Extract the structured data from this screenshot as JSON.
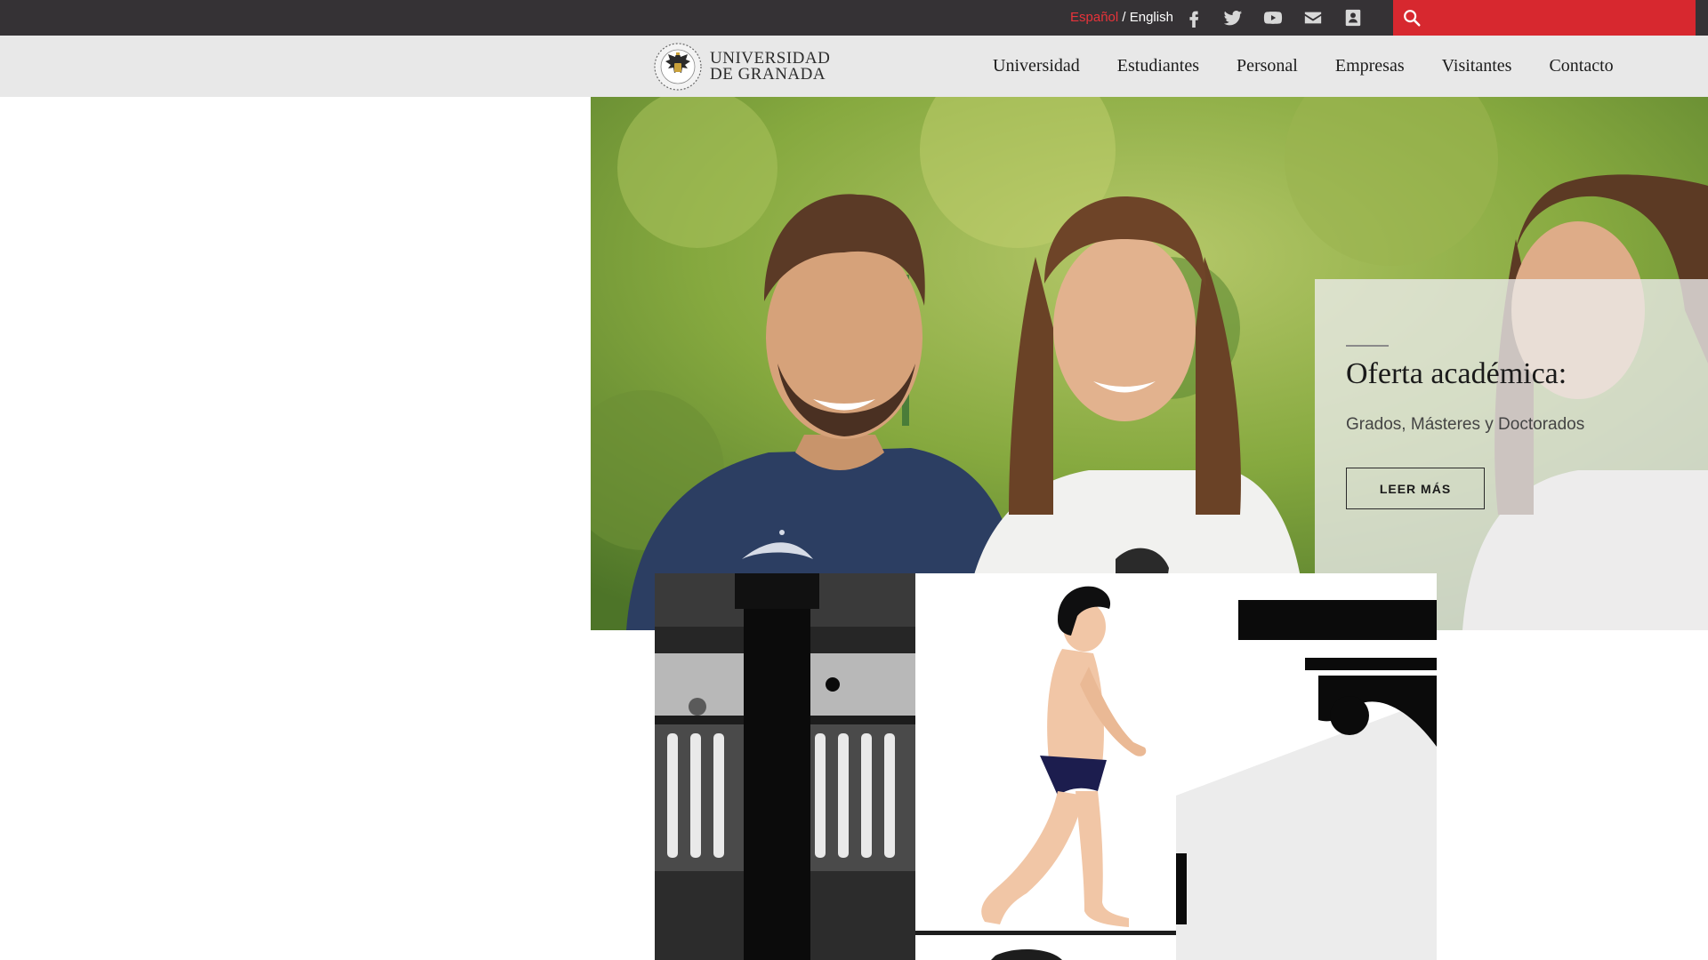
{
  "topbar": {
    "lang_active": "Español",
    "lang_separator": " / ",
    "lang_alt": "English",
    "social_icons": [
      "facebook-icon",
      "twitter-icon",
      "youtube-icon",
      "email-icon",
      "directory-icon"
    ],
    "search_placeholder": "",
    "search_icon": "search-icon",
    "background_color": "#353235",
    "accent_color": "#d7282f"
  },
  "header": {
    "logo_line1": "UNIVERSIDAD",
    "logo_line2": "DE GRANADA",
    "nav": [
      "Universidad",
      "Estudiantes",
      "Personal",
      "Empresas",
      "Visitantes",
      "Contacto"
    ]
  },
  "hero": {
    "title": "Oferta académica:",
    "subtitle": "Grados, Másteres y Doctorados",
    "button_label": "LEER MÁS"
  },
  "tiles": [
    "courtyard-photo-tile",
    "walking-figure-illustration-tile",
    "document-detail-tile"
  ]
}
